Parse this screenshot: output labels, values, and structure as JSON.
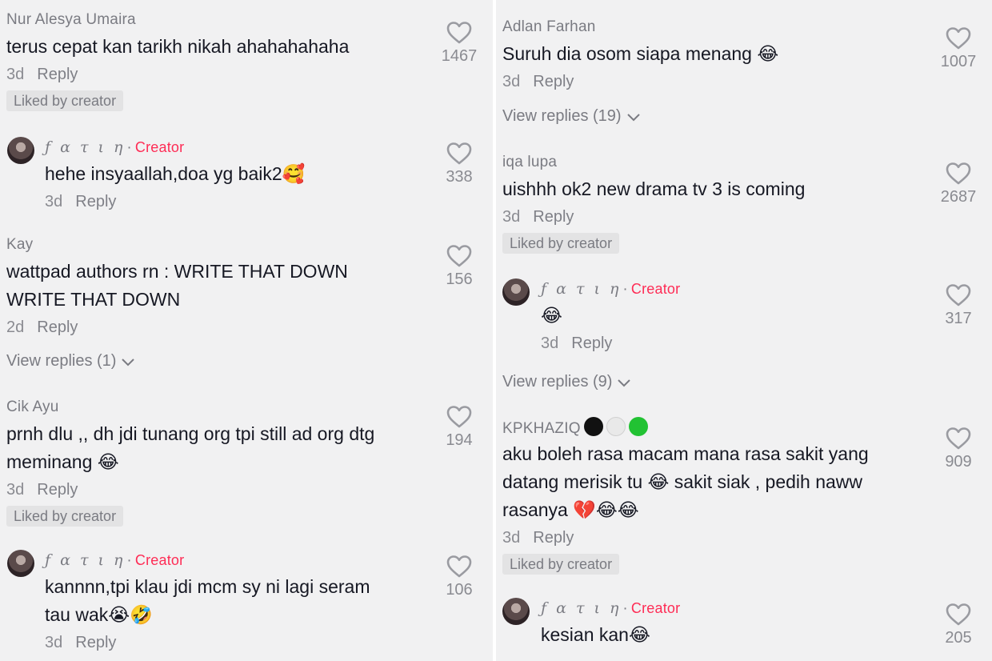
{
  "left": {
    "c1": {
      "username": "Nur Alesya Umaira",
      "text": "terus cepat kan tarikh nikah ahahahahaha",
      "age": "3d",
      "reply": "Reply",
      "badge": "Liked by creator",
      "likes": "1467"
    },
    "r1": {
      "username": "ƒ α τ ι η",
      "creator": "Creator",
      "text": "hehe insyaallah,doa yg baik2🥰",
      "age": "3d",
      "reply": "Reply",
      "likes": "338"
    },
    "c2": {
      "username": "Kay",
      "text_line1": "wattpad authors rn : WRITE THAT DOWN",
      "text_line2": "WRITE THAT DOWN",
      "age": "2d",
      "reply": "Reply",
      "view_replies": "View replies (1)",
      "likes": "156"
    },
    "c3": {
      "username": "Cik Ayu",
      "text_line1": "prnh dlu ,, dh jdi tunang org tpi still ad org dtg",
      "text_line2": "meminang 😂",
      "age": "3d",
      "reply": "Reply",
      "badge": "Liked by creator",
      "likes": "194"
    },
    "r2": {
      "username": "ƒ α τ ι η",
      "creator": "Creator",
      "text_line1": "kannnn,tpi klau jdi mcm sy ni lagi seram",
      "text_line2": "tau wak😭🤣",
      "age": "3d",
      "reply": "Reply",
      "likes": "106"
    }
  },
  "right": {
    "c1": {
      "username": "Adlan Farhan",
      "text": "Suruh dia osom siapa menang 😂",
      "age": "3d",
      "reply": "Reply",
      "view_replies": "View replies (19)",
      "likes": "1007"
    },
    "c2": {
      "username": "iqa lupa",
      "text": "uishhh ok2 new drama tv 3 is coming",
      "age": "3d",
      "reply": "Reply",
      "badge": "Liked by creator",
      "likes": "2687"
    },
    "r1": {
      "username": "ƒ α τ ι η",
      "creator": "Creator",
      "text": "😂",
      "age": "3d",
      "reply": "Reply",
      "view_replies": "View replies (9)",
      "likes": "317"
    },
    "c3": {
      "username": "KPKHAZIQ",
      "ball_colors": [
        "#111111",
        "#eeeeee",
        "#22c233"
      ],
      "text_line1": "aku boleh rasa macam mana rasa sakit yang",
      "text_line2": "datang merisik tu 😂 sakit siak , pedih naww",
      "text_line3": "rasanya 💔😂😂",
      "age": "3d",
      "reply": "Reply",
      "badge": "Liked by creator",
      "likes": "909"
    },
    "r2": {
      "username": "ƒ α τ ι η",
      "creator": "Creator",
      "text": "kesian kan😂",
      "likes": "205"
    }
  },
  "colors": {
    "background": "#f1f1f2",
    "creator_red": "#fe2c55",
    "muted_text": "#8a8b91"
  },
  "icons": {
    "like": "heart-outline-icon",
    "expand": "chevron-down-icon"
  }
}
